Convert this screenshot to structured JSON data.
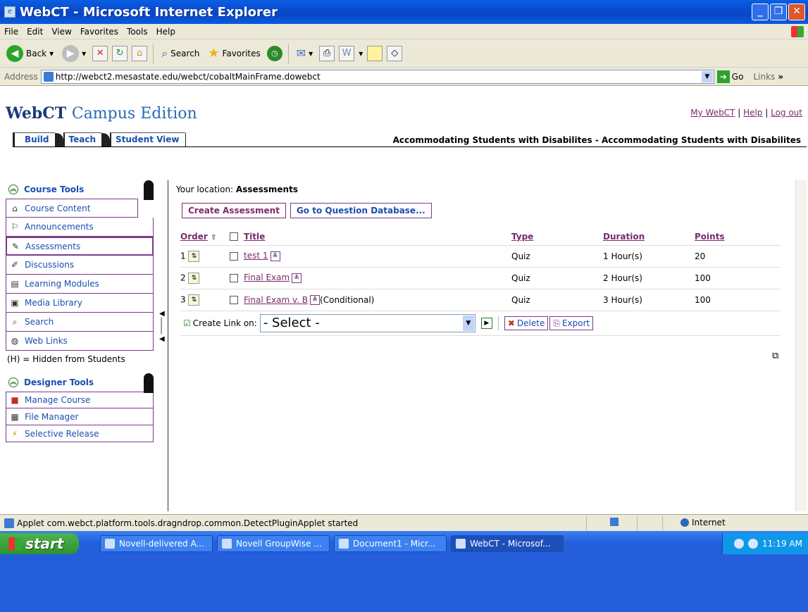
{
  "window": {
    "title": "WebCT - Microsoft Internet Explorer"
  },
  "menu": [
    "File",
    "Edit",
    "View",
    "Favorites",
    "Tools",
    "Help"
  ],
  "toolbar": {
    "back": "Back",
    "search": "Search",
    "favorites": "Favorites"
  },
  "address": {
    "label": "Address",
    "url": "http://webct2.mesastate.edu/webct/cobaltMainFrame.dowebct",
    "go": "Go",
    "links": "Links"
  },
  "header": {
    "brand_a": "WebCT",
    "brand_b": "Campus Edition",
    "links": [
      "My WebCT",
      "Help",
      "Log out"
    ],
    "course_title": "Accommodating Students with Disabilites - Accommodating Students with Disabilites",
    "tabs": [
      "Build",
      "Teach",
      "Student View"
    ]
  },
  "sidebar": {
    "course_tools": "Course Tools",
    "items": [
      "Course Content",
      "Announcements",
      "Assessments",
      "Discussions",
      "Learning Modules",
      "Media Library",
      "Search",
      "Web Links"
    ],
    "hidden_note": "(H) = Hidden from Students",
    "designer_tools": "Designer Tools",
    "designer_items": [
      "Manage Course",
      "File Manager",
      "Selective Release"
    ]
  },
  "main": {
    "location_label": "Your location:",
    "location": "Assessments",
    "create_btn": "Create Assessment",
    "qdb_btn": "Go to Question Database...",
    "columns": {
      "order": "Order",
      "title": "Title",
      "type": "Type",
      "duration": "Duration",
      "points": "Points"
    },
    "rows": [
      {
        "order": "1",
        "title": "test 1",
        "extra": "",
        "type": "Quiz",
        "duration": "1 Hour(s)",
        "points": "20"
      },
      {
        "order": "2",
        "title": "Final Exam",
        "extra": "",
        "type": "Quiz",
        "duration": "2 Hour(s)",
        "points": "100"
      },
      {
        "order": "3",
        "title": "Final Exam v. B",
        "extra": "(Conditional)",
        "type": "Quiz",
        "duration": "3 Hour(s)",
        "points": "100"
      }
    ],
    "create_link_label": "Create Link on:",
    "select_value": "- Select -",
    "delete": "Delete",
    "export": "Export"
  },
  "status": {
    "text": "Applet com.webct.platform.tools.dragndrop.common.DetectPluginApplet started",
    "zone": "Internet"
  },
  "taskbar": {
    "start": "start",
    "tasks": [
      "Novell-delivered A...",
      "Novell GroupWise ...",
      "Document1 - Micr...",
      "WebCT - Microsof..."
    ],
    "clock": "11:19 AM"
  }
}
